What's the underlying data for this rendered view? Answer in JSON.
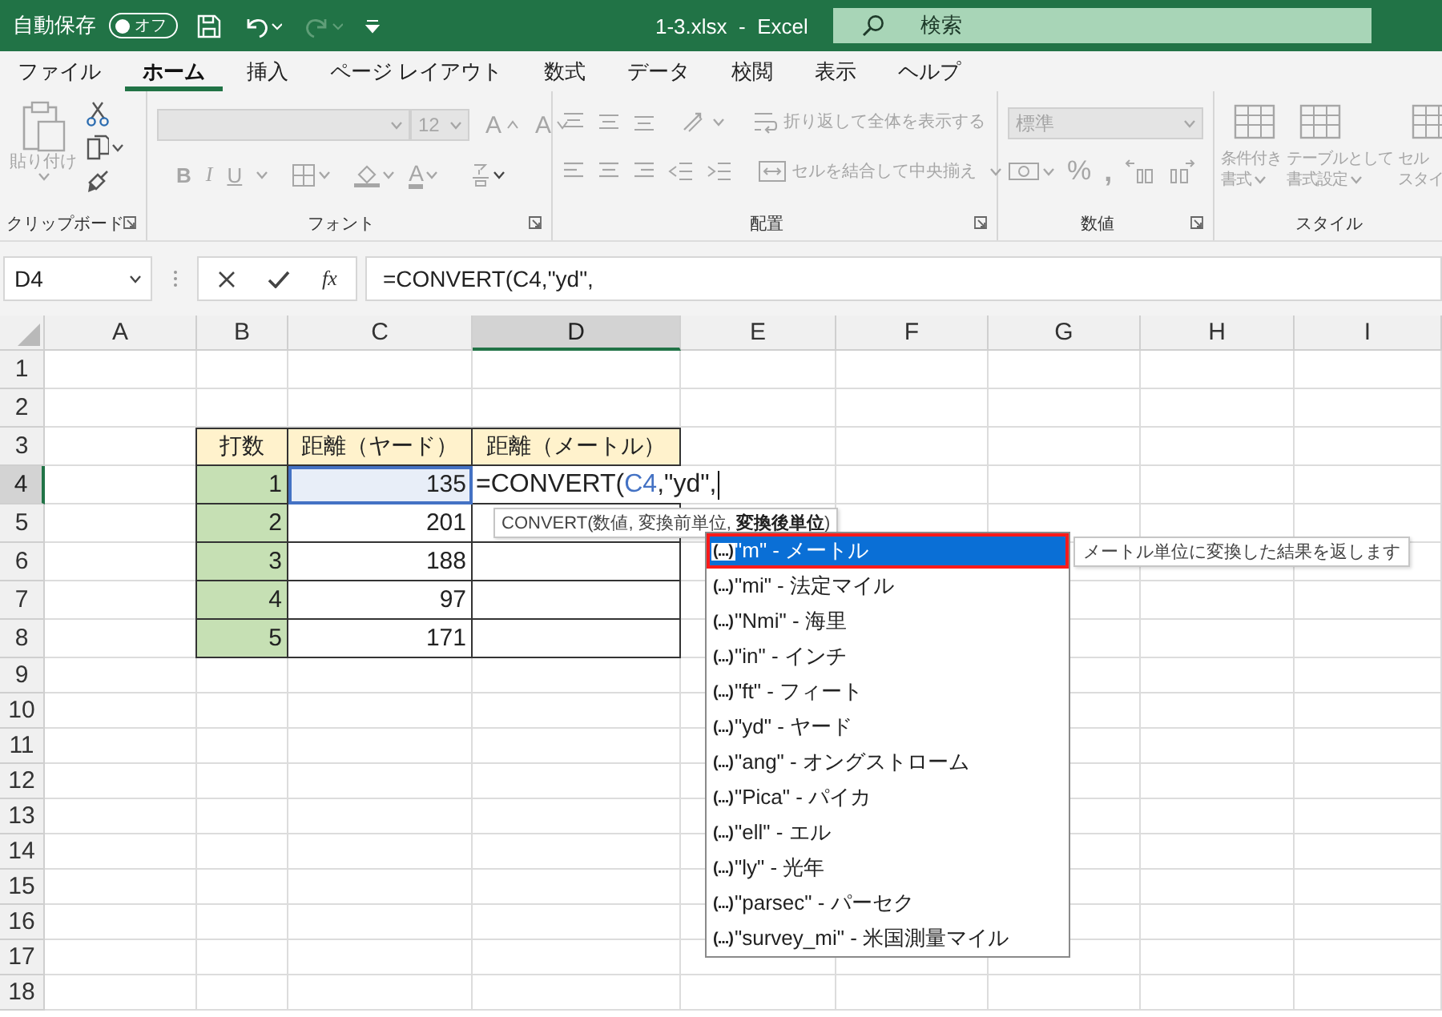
{
  "window": {
    "autosave_label": "自動保存",
    "autosave_toggle": {
      "label": "オフ",
      "on": false
    },
    "title": "1-3.xlsx  -  Excel",
    "search": {
      "placeholder": "検索"
    }
  },
  "ribbon_tabs": [
    {
      "label": "ファイル",
      "selected": false
    },
    {
      "label": "ホーム",
      "selected": true
    },
    {
      "label": "挿入",
      "selected": false
    },
    {
      "label": "ページ レイアウト",
      "selected": false
    },
    {
      "label": "数式",
      "selected": false
    },
    {
      "label": "データ",
      "selected": false
    },
    {
      "label": "校閲",
      "selected": false
    },
    {
      "label": "表示",
      "selected": false
    },
    {
      "label": "ヘルプ",
      "selected": false
    }
  ],
  "ribbon": {
    "disabled": true,
    "groups": [
      {
        "kind": "clipboard",
        "label": "クリップボード",
        "paste_label": "貼り付け"
      },
      {
        "kind": "font",
        "label": "フォント",
        "font_size": "12",
        "grow": "A",
        "shrink": "A",
        "bold": "B",
        "italic": "I",
        "underline": "U",
        "font_color": "A"
      },
      {
        "kind": "alignment",
        "label": "配置",
        "wrap": "折り返して全体を表示する",
        "merge": "セルを結合して中央揃え"
      },
      {
        "kind": "number",
        "label": "数値",
        "format": "標準",
        "percent": "%",
        "comma": ","
      },
      {
        "kind": "styles",
        "label": "スタイル",
        "items": [
          {
            "lines": [
              "条件付き",
              "書式"
            ],
            "dropdown": true
          },
          {
            "lines": [
              "テーブルとして",
              "書式設定"
            ],
            "dropdown": true
          },
          {
            "lines": [
              "セル",
              "スタイ"
            ]
          }
        ]
      }
    ]
  },
  "formula_bar": {
    "name_box": "D4",
    "function_button": "fx",
    "formula": "=CONVERT(C4,\"yd\","
  },
  "sheet": {
    "columns": [
      {
        "label": "A",
        "selected": false
      },
      {
        "label": "B",
        "selected": false
      },
      {
        "label": "C",
        "selected": false
      },
      {
        "label": "D",
        "selected": true
      },
      {
        "label": "E",
        "selected": false
      },
      {
        "label": "F",
        "selected": false
      },
      {
        "label": "G",
        "selected": false
      },
      {
        "label": "H",
        "selected": false
      },
      {
        "label": "I",
        "selected": false
      }
    ],
    "rows": [
      {
        "label": "1",
        "selected": false
      },
      {
        "label": "2",
        "selected": false
      },
      {
        "label": "3",
        "selected": false,
        "cells": [
          {
            "kind": "blank"
          },
          {
            "kind": "header",
            "text": "打数"
          },
          {
            "kind": "header",
            "text": "距離（ヤード）"
          },
          {
            "kind": "header",
            "text": "距離（メートル）"
          }
        ]
      },
      {
        "label": "4",
        "selected": true,
        "cells": [
          {
            "kind": "blank"
          },
          {
            "kind": "index",
            "text": "1"
          },
          {
            "kind": "reference",
            "text": "135"
          },
          {
            "kind": "editing",
            "parts": [
              {
                "kind": "text",
                "text": "=CONVERT("
              },
              {
                "kind": "ref",
                "text": "C4"
              },
              {
                "kind": "text",
                "text": ",\"yd\","
              }
            ]
          }
        ]
      },
      {
        "label": "5",
        "selected": false,
        "cells": [
          {
            "kind": "blank"
          },
          {
            "kind": "index",
            "text": "2"
          },
          {
            "kind": "number",
            "text": "201"
          },
          {
            "kind": "table_blank"
          }
        ]
      },
      {
        "label": "6",
        "selected": false,
        "cells": [
          {
            "kind": "blank"
          },
          {
            "kind": "index",
            "text": "3"
          },
          {
            "kind": "number",
            "text": "188"
          },
          {
            "kind": "table_blank"
          }
        ]
      },
      {
        "label": "7",
        "selected": false,
        "cells": [
          {
            "kind": "blank"
          },
          {
            "kind": "index",
            "text": "4"
          },
          {
            "kind": "number",
            "text": "97"
          },
          {
            "kind": "table_blank"
          }
        ]
      },
      {
        "label": "8",
        "selected": false,
        "cells": [
          {
            "kind": "blank"
          },
          {
            "kind": "index",
            "text": "5"
          },
          {
            "kind": "number",
            "text": "171"
          },
          {
            "kind": "table_blank"
          }
        ]
      },
      {
        "label": "9",
        "selected": false
      },
      {
        "label": "10",
        "selected": false
      },
      {
        "label": "11",
        "selected": false
      },
      {
        "label": "12",
        "selected": false
      },
      {
        "label": "13",
        "selected": false
      },
      {
        "label": "14",
        "selected": false
      },
      {
        "label": "15",
        "selected": false
      },
      {
        "label": "16",
        "selected": false
      },
      {
        "label": "17",
        "selected": false
      },
      {
        "label": "18",
        "selected": false
      }
    ]
  },
  "tooltip": "CONVERT(数値, 変換前単位, **変換後単位**)",
  "autocomplete": {
    "items": [
      {
        "badge": "(...)",
        "text": "\"m\" - メートル",
        "selected": true,
        "outlined": true
      },
      {
        "badge": "(...)",
        "text": "\"mi\" - 法定マイル",
        "selected": false,
        "outlined": false
      },
      {
        "badge": "(...)",
        "text": "\"Nmi\" - 海里",
        "selected": false,
        "outlined": false
      },
      {
        "badge": "(...)",
        "text": "\"in\" - インチ",
        "selected": false,
        "outlined": false
      },
      {
        "badge": "(...)",
        "text": "\"ft\" - フィート",
        "selected": false,
        "outlined": false
      },
      {
        "badge": "(...)",
        "text": "\"yd\" - ヤード",
        "selected": false,
        "outlined": false
      },
      {
        "badge": "(...)",
        "text": "\"ang\" - オングストローム",
        "selected": false,
        "outlined": false
      },
      {
        "badge": "(...)",
        "text": "\"Pica\" - パイカ",
        "selected": false,
        "outlined": false
      },
      {
        "badge": "(...)",
        "text": "\"ell\" - エル",
        "selected": false,
        "outlined": false
      },
      {
        "badge": "(...)",
        "text": "\"ly\" - 光年",
        "selected": false,
        "outlined": false
      },
      {
        "badge": "(...)",
        "text": "\"parsec\" - パーセク",
        "selected": false,
        "outlined": false
      },
      {
        "badge": "(...)",
        "text": "\"survey_mi\" - 米国測量マイル",
        "selected": false,
        "outlined": false
      }
    ],
    "tip": "メートル単位に変換した結果を返します"
  }
}
